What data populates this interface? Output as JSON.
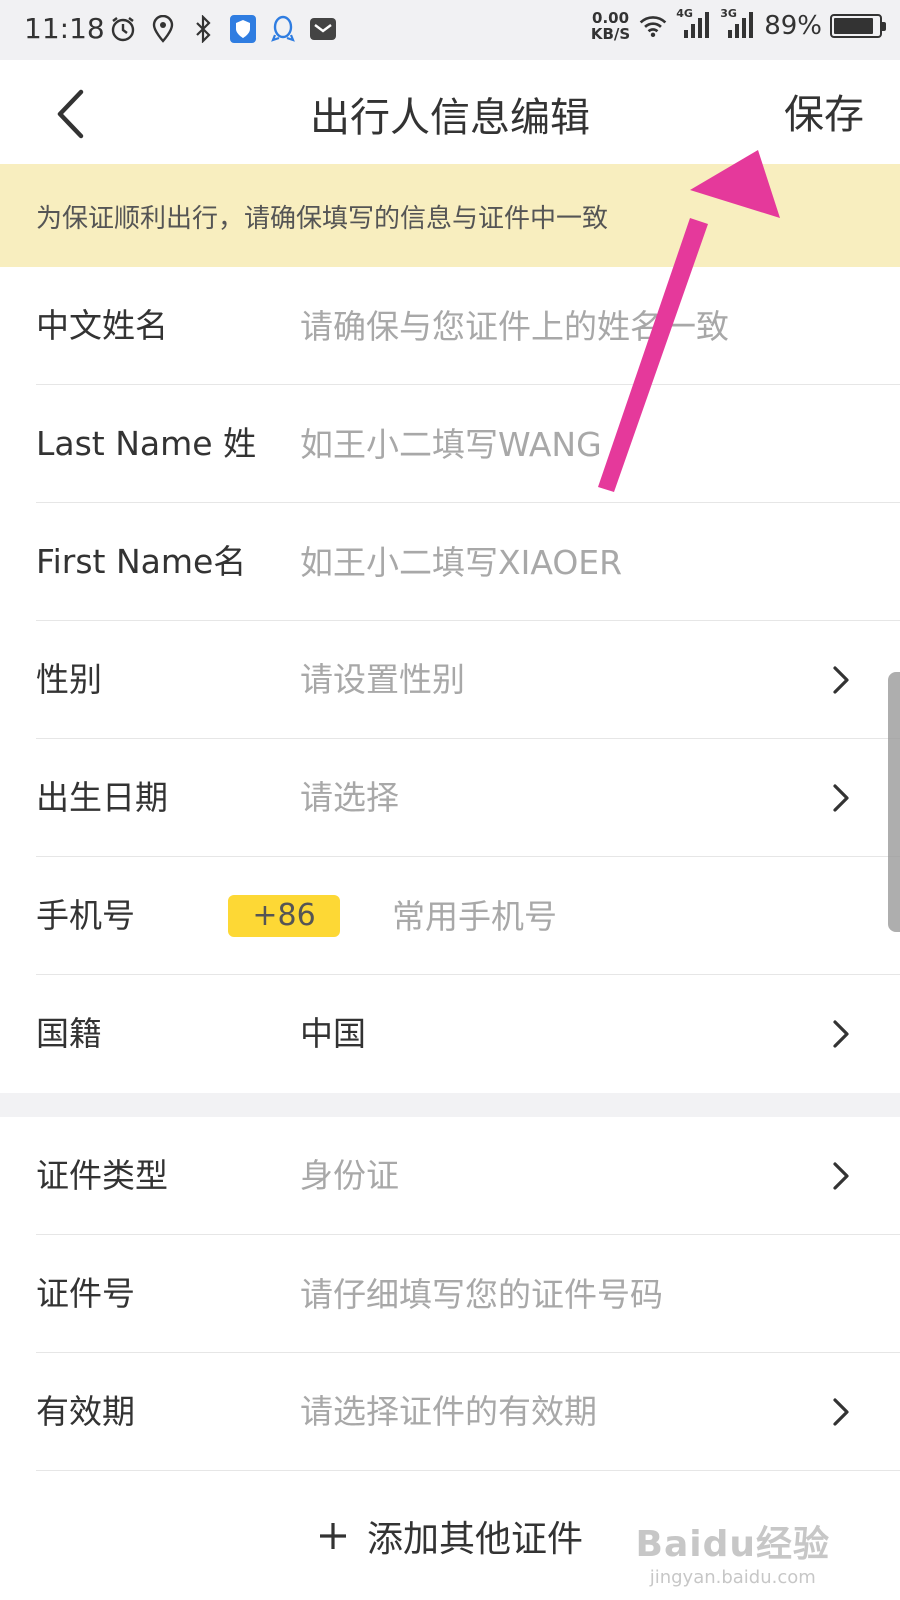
{
  "status_bar": {
    "time": "11:18",
    "net_speed_value": "0.00",
    "net_speed_unit": "KB/S",
    "net_4g": "4G",
    "net_3g": "3G",
    "battery_pct": "89%",
    "battery_level": 0.89
  },
  "header": {
    "title": "出行人信息编辑",
    "save_label": "保存"
  },
  "notice": {
    "text": "为保证顺利出行，请确保填写的信息与证件中一致"
  },
  "form": {
    "chinese_name": {
      "label": "中文姓名",
      "placeholder": "请确保与您证件上的姓名一致"
    },
    "last_name": {
      "label": "Last Name 姓",
      "placeholder": "如王小二填写WANG"
    },
    "first_name": {
      "label": "First Name名",
      "placeholder": "如王小二填写XIAOER"
    },
    "gender": {
      "label": "性别",
      "placeholder": "请设置性别"
    },
    "birth_date": {
      "label": "出生日期",
      "placeholder": "请选择"
    },
    "phone": {
      "label": "手机号",
      "country_code": "+86",
      "placeholder": "常用手机号"
    },
    "nationality": {
      "label": "国籍",
      "value": "中国"
    },
    "doc_type": {
      "label": "证件类型",
      "placeholder": "身份证"
    },
    "doc_number": {
      "label": "证件号",
      "placeholder": "请仔细填写您的证件号码"
    },
    "validity": {
      "label": "有效期",
      "placeholder": "请选择证件的有效期"
    }
  },
  "add_document": {
    "label": "添加其他证件"
  },
  "watermark": {
    "logo": "Baidu经验",
    "sub": "jingyan.baidu.com"
  },
  "colors": {
    "notice_bg": "#f8eebf",
    "country_code_bg": "#fdd835",
    "arrow": "#e5399b",
    "placeholder": "#a8a8a8"
  }
}
